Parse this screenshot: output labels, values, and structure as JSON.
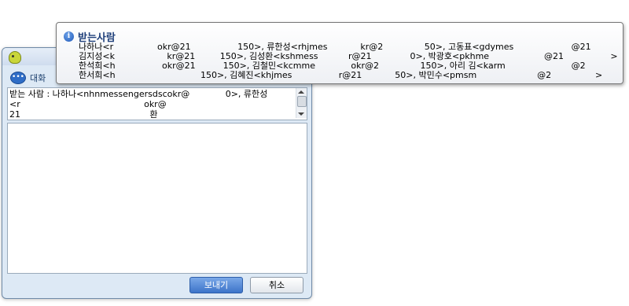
{
  "chat_window": {
    "tab_label": "대화",
    "recipient_text": "받는 사람 : 나하나<nhnmessengersdscokr@             0>, 류한성\n<r                                             okr@\n21                                               환",
    "send_button": "보내기",
    "cancel_button": "취소"
  },
  "tooltip": {
    "title": "받는사람",
    "lines": [
      "나하나<r                okr@21                 150>, 류한성<rhjmes            kr@2               50>, 고동표<gdymes                     @21                 >",
      "김지성<k                   kr@21         150>, 김성환<kshmess           r@21              0>, 박광호<pkhme                    @21                 >",
      "한석희<h                 okr@21          150>, 김철민<kcmme             okr@2               150>, 아리 김<karm                        @2              50>",
      "한서희<h                               150>, 김혜진<khjmes                 r@21            50>, 박민수<pmsm                      @2                >"
    ]
  }
}
